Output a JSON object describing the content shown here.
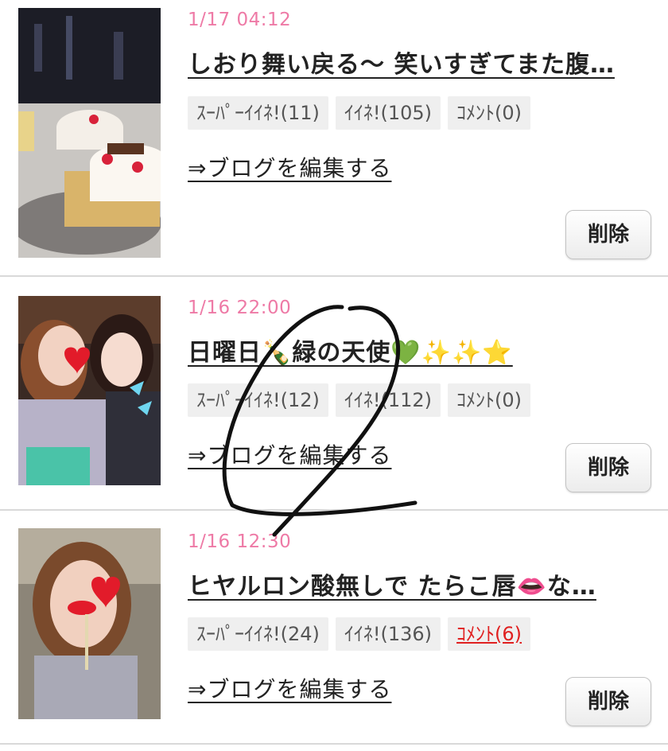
{
  "entries": [
    {
      "date": "1/17 04:12",
      "title": "しおり舞い戻る〜 笑いすぎてまた腹…",
      "super_like": "ｽｰﾊﾟｰｲｲﾈ!(11)",
      "like": "ｲｲﾈ!(105)",
      "comment": "ｺﾒﾝﾄ(0)",
      "edit_link": "⇒ブログを編集する",
      "delete_label": "削除"
    },
    {
      "date": "1/16 22:00",
      "title": "日曜日🍾緑の天使💚✨✨⭐",
      "super_like": "ｽｰﾊﾟｰｲｲﾈ!(12)",
      "like": "ｲｲﾈ!(112)",
      "comment": "ｺﾒﾝﾄ(0)",
      "edit_link": "⇒ブログを編集する",
      "delete_label": "削除"
    },
    {
      "date": "1/16 12:30",
      "title": "ヒヤルロン酸無しで たらこ唇👄な…",
      "super_like": "ｽｰﾊﾟｰｲｲﾈ!(24)",
      "like": "ｲｲﾈ!(136)",
      "comment": "ｺﾒﾝﾄ(6)",
      "edit_link": "⇒ブログを編集する",
      "delete_label": "削除"
    }
  ],
  "colors": {
    "date": "#ee7aa6",
    "comment_highlight": "#e02020",
    "badge_bg": "#efefef",
    "divider": "#d9d9d9"
  }
}
